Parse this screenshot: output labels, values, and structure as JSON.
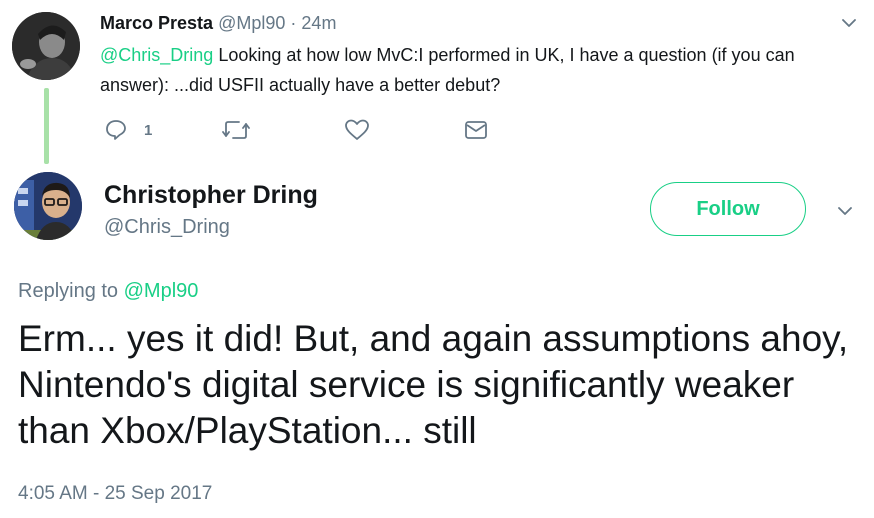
{
  "parent_tweet": {
    "display_name": "Marco Presta",
    "handle": "@Mpl90",
    "separator": "·",
    "time_ago": "24m",
    "mention": "@Chris_Dring",
    "text_after_mention": " Looking at how low MvC:I performed in UK, I have a question (if you can answer): ...did USFII actually have a better debut?",
    "reply_count": "1",
    "icons": [
      "reply-icon",
      "retweet-icon",
      "like-icon",
      "direct-message-icon",
      "chevron-down-icon"
    ]
  },
  "main_tweet": {
    "display_name": "Christopher Dring",
    "handle": "@Chris_Dring",
    "follow_label": "Follow",
    "replying_prefix": "Replying to ",
    "replying_handle": "@Mpl90",
    "text": "Erm... yes it did! But, and again assumptions ahoy, Nintendo's digital service is significantly weaker than Xbox/PlayStation... still",
    "timestamp": "4:05 AM - 25 Sep 2017"
  },
  "colors": {
    "accent": "#19cf86",
    "thread_line": "#a8e1a8",
    "secondary_text": "#657786",
    "primary_text": "#14171a"
  }
}
